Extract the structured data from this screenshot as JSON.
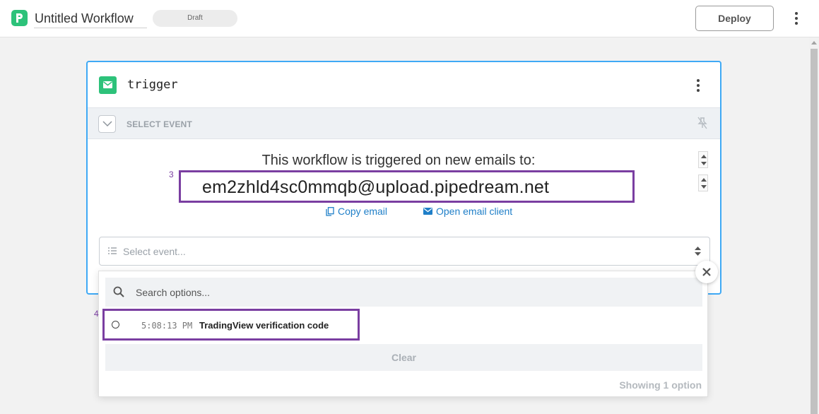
{
  "header": {
    "title": "Untitled Workflow",
    "status": "Draft",
    "deploy_label": "Deploy"
  },
  "trigger": {
    "step_name": "trigger",
    "select_event_label": "SELECT EVENT",
    "triggered_text": "This workflow is triggered on new emails to:",
    "email": "em2zhld4sc0mmqb@upload.pipedream.net",
    "copy_email_label": "Copy email",
    "open_client_label": "Open email client",
    "event_placeholder": "Select event..."
  },
  "annotations": {
    "email_marker": "3",
    "option_marker": "4"
  },
  "dropdown": {
    "search_placeholder": "Search options...",
    "options": [
      {
        "time": "5:08:13 PM",
        "label": "TradingView verification code"
      }
    ],
    "clear_label": "Clear",
    "showing_text": "Showing 1 option"
  },
  "colors": {
    "brand_green": "#2dc27a",
    "focus_blue": "#3fa9f5",
    "annotation_purple": "#7a3ea1",
    "link_blue": "#1f7fc8"
  },
  "icons": [
    "pipedream-logo-icon",
    "more-vertical-icon",
    "mail-icon",
    "chevron-down-icon",
    "pin-off-icon",
    "copy-icon",
    "envelope-icon",
    "list-icon",
    "sort-icon",
    "search-icon",
    "close-icon"
  ]
}
